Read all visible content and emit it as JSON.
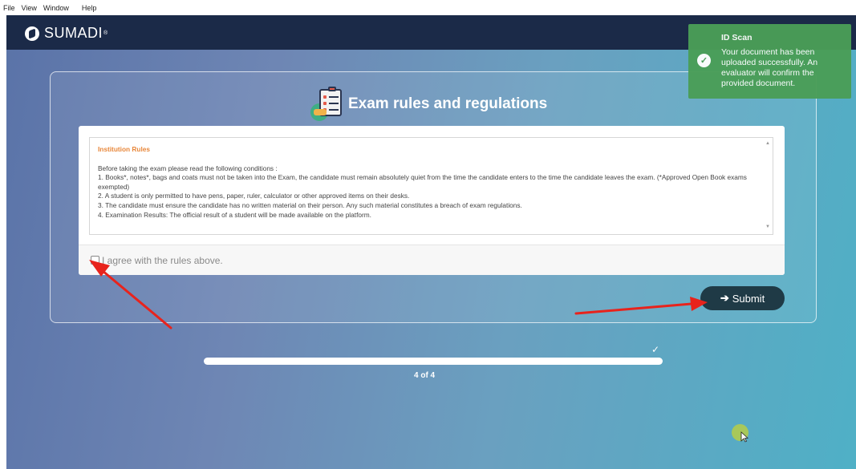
{
  "menubar": {
    "items": [
      "File",
      "View",
      "Window",
      "Help"
    ]
  },
  "brand": {
    "name": "SUMADI",
    "trademark": "®"
  },
  "page": {
    "title": "Exam rules and regulations"
  },
  "rules": {
    "heading": "Institution Rules",
    "intro": "Before taking the exam please read the following conditions :",
    "items": [
      "1. Books*, notes*, bags and coats must not be taken into the Exam, the candidate must remain absolutely quiet from the time the candidate enters to the time the candidate leaves the exam. (*Approved Open Book exams exempted)",
      "2. A student is only permitted to have pens, paper, ruler, calculator or other approved items on their desks.",
      "3. The candidate must ensure the candidate has no written material on their person. Any such material constitutes a breach of exam regulations.",
      "4. Examination Results: The official result of a student will be made available on the platform."
    ]
  },
  "agree": {
    "label": "I agree with the rules above.",
    "checked": false
  },
  "submit": {
    "label": "Submit",
    "icon": "arrow-right-icon"
  },
  "progress": {
    "text": "4 of 4",
    "current": 4,
    "total": 4,
    "fraction": 1.0
  },
  "toast": {
    "title": "ID Scan",
    "message": "Your document has been uploaded successfully. An evaluator will confirm the provided document.",
    "icon": "check-circle-icon",
    "color": "#4a9e57"
  },
  "colors": {
    "topbar": "#1b2a48",
    "accent_orange": "#e8873a",
    "submit_bg": "#1f3a46",
    "annotation_red": "#e8231c"
  }
}
